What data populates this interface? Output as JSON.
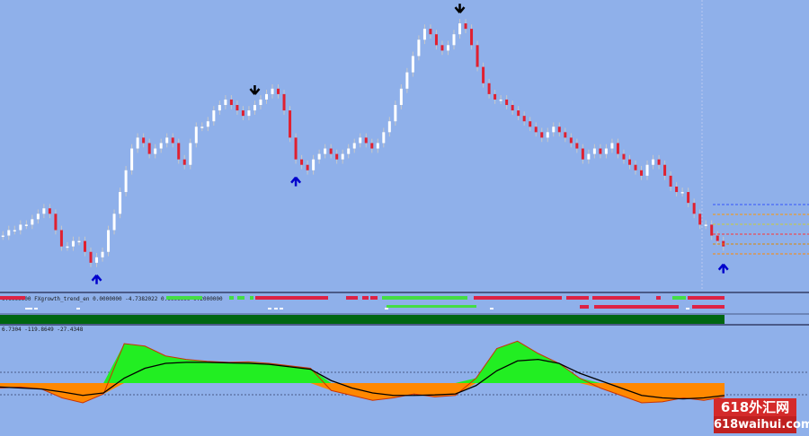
{
  "chart_data": [
    {
      "type": "candlestick",
      "panel": "main-price",
      "title": "",
      "close_series": [
        0.62,
        0.63,
        0.63,
        0.64,
        0.64,
        0.65,
        0.66,
        0.67,
        0.66,
        0.63,
        0.6,
        0.6,
        0.61,
        0.61,
        0.59,
        0.57,
        0.58,
        0.59,
        0.63,
        0.66,
        0.7,
        0.74,
        0.78,
        0.8,
        0.79,
        0.77,
        0.78,
        0.79,
        0.8,
        0.79,
        0.76,
        0.75,
        0.79,
        0.82,
        0.82,
        0.83,
        0.85,
        0.86,
        0.87,
        0.86,
        0.85,
        0.84,
        0.85,
        0.86,
        0.87,
        0.88,
        0.89,
        0.88,
        0.85,
        0.8,
        0.76,
        0.75,
        0.74,
        0.76,
        0.77,
        0.78,
        0.77,
        0.76,
        0.77,
        0.78,
        0.79,
        0.8,
        0.79,
        0.78,
        0.79,
        0.81,
        0.83,
        0.86,
        0.89,
        0.92,
        0.95,
        0.98,
        1.0,
        0.99,
        0.97,
        0.96,
        0.97,
        0.99,
        1.01,
        1.0,
        0.97,
        0.93,
        0.9,
        0.88,
        0.87,
        0.87,
        0.86,
        0.85,
        0.84,
        0.83,
        0.82,
        0.81,
        0.8,
        0.81,
        0.82,
        0.81,
        0.8,
        0.79,
        0.78,
        0.76,
        0.77,
        0.78,
        0.77,
        0.78,
        0.79,
        0.77,
        0.76,
        0.75,
        0.74,
        0.73,
        0.75,
        0.76,
        0.75,
        0.73,
        0.71,
        0.7,
        0.7,
        0.68,
        0.66,
        0.64,
        0.64,
        0.62,
        0.61,
        0.6
      ],
      "ylim": [
        0,
        1
      ],
      "up_color": "#ffffff",
      "down_color": "#e02030",
      "arrows": [
        {
          "index": 16,
          "direction": "up",
          "color": "#0000cc"
        },
        {
          "index": 43,
          "direction": "down",
          "color": "#000000"
        },
        {
          "index": 50,
          "direction": "up",
          "color": "#0000cc"
        },
        {
          "index": 78,
          "direction": "down",
          "color": "#000000"
        },
        {
          "index": 123,
          "direction": "up",
          "color": "#0000cc"
        }
      ],
      "level_colors": [
        "#3355ff",
        "#ff9900",
        "#cccc33",
        "#ff3333",
        "#dd8800",
        "#ff8800"
      ]
    },
    {
      "type": "area",
      "panel": "oscillator",
      "header_text": "6.7304 -119.8649 -27.4348",
      "x": [
        0,
        4,
        8,
        12,
        16,
        20,
        24,
        28,
        32,
        36,
        40,
        44,
        48,
        52,
        56,
        60,
        64,
        68,
        72,
        76,
        80,
        84,
        88,
        92,
        96,
        100,
        104,
        108,
        112,
        116,
        120,
        124,
        128,
        132,
        136,
        140
      ],
      "values": [
        -10,
        -8,
        -12,
        -30,
        -40,
        -22,
        80,
        75,
        55,
        48,
        44,
        42,
        43,
        40,
        35,
        30,
        -15,
        -25,
        -35,
        -30,
        -22,
        -28,
        -25,
        10,
        70,
        85,
        60,
        40,
        10,
        -10,
        -25,
        -40,
        -38,
        -30,
        -35,
        -28
      ],
      "signal": [
        -8,
        -10,
        -12,
        -18,
        -25,
        -20,
        10,
        30,
        40,
        42,
        42,
        41,
        40,
        38,
        33,
        28,
        5,
        -10,
        -20,
        -25,
        -25,
        -24,
        -22,
        -5,
        25,
        45,
        48,
        40,
        20,
        5,
        -10,
        -25,
        -30,
        -32,
        -30,
        -25
      ],
      "ylim": [
        -60,
        100
      ],
      "positive_color": "#22ee22",
      "negative_color": "#ff8800"
    }
  ],
  "strip": {
    "label": "0.0000000 FXgrowth_trend_en 0.0000000 -4.7382022 0.0000000 0.2000000",
    "colors": {
      "green": "#44dd44",
      "red": "#dd2244",
      "dark_green": "#006611",
      "white": "#ffffff"
    }
  },
  "watermark": {
    "line1": "618外汇网",
    "line2": "618waihui.com"
  }
}
